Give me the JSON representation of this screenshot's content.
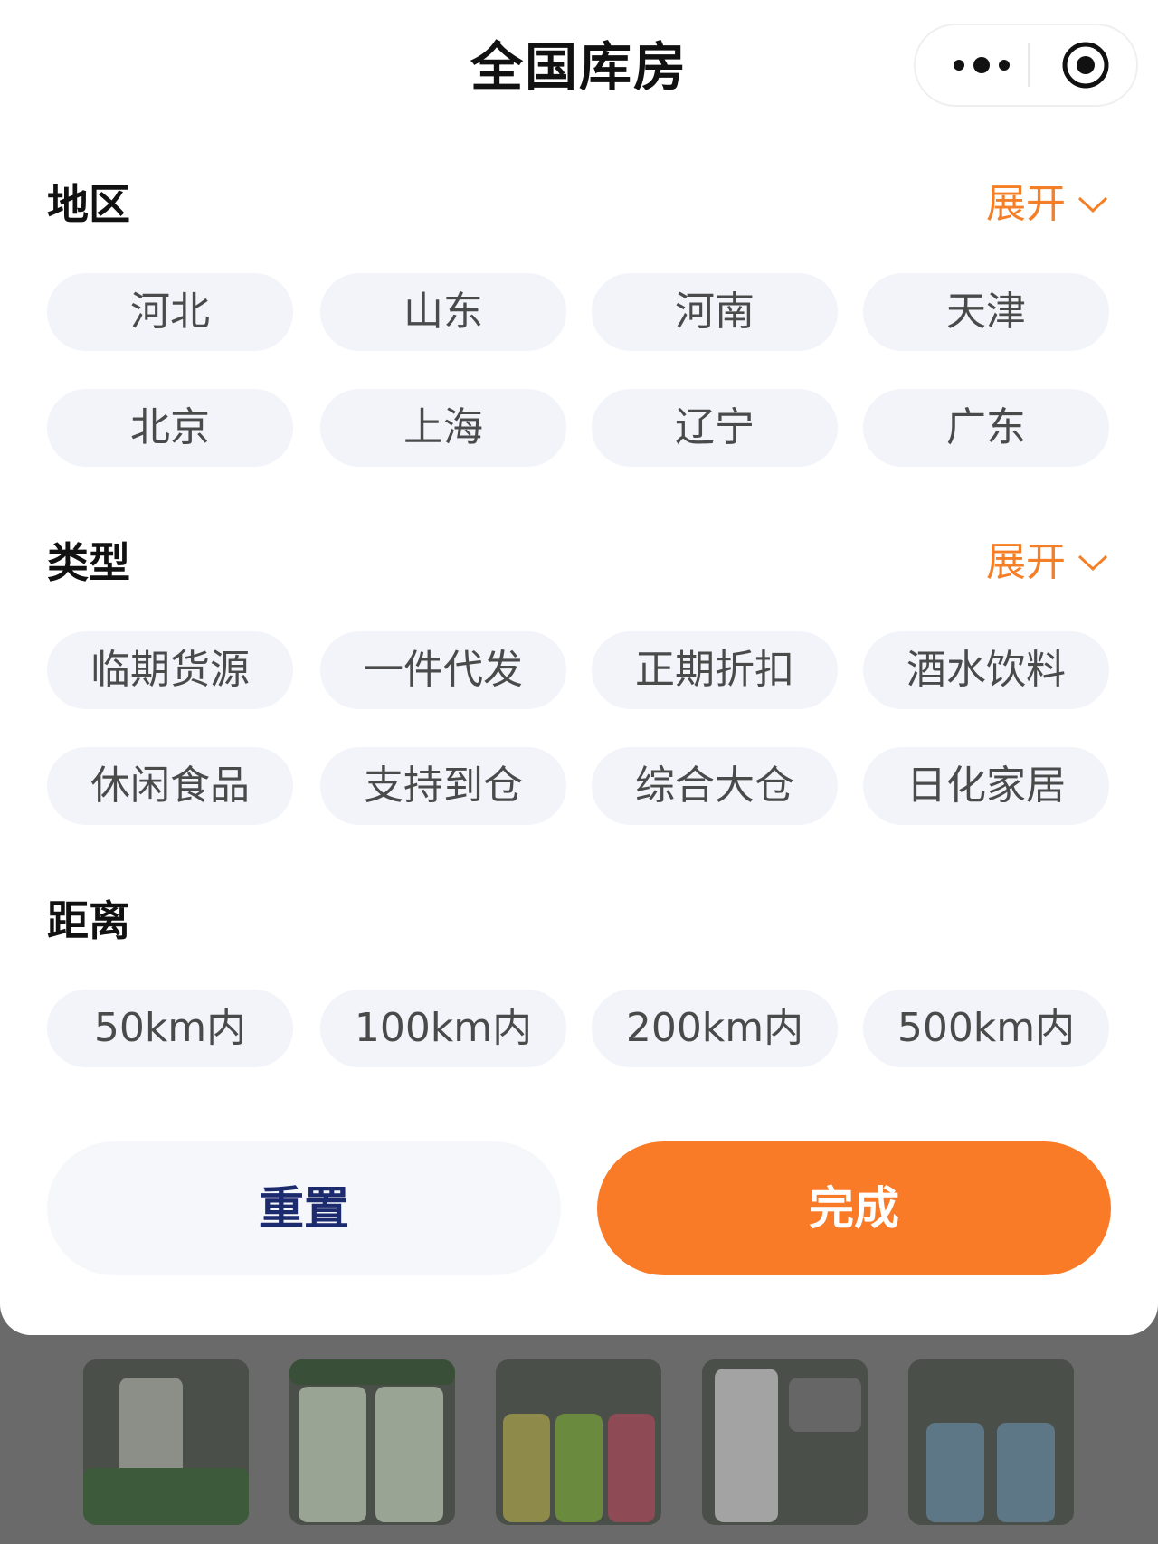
{
  "header": {
    "title": "全国库房",
    "more_icon": "more-dots-icon",
    "close_icon": "target-circle-icon"
  },
  "sections": {
    "region": {
      "title": "地区",
      "expand_label": "展开",
      "options": [
        "河北",
        "山东",
        "河南",
        "天津",
        "北京",
        "上海",
        "辽宁",
        "广东"
      ]
    },
    "type": {
      "title": "类型",
      "expand_label": "展开",
      "options": [
        "临期货源",
        "一件代发",
        "正期折扣",
        "酒水饮料",
        "休闲食品",
        "支持到仓",
        "综合大仓",
        "日化家居"
      ]
    },
    "distance": {
      "title": "距离",
      "options": [
        "50km内",
        "100km内",
        "200km内",
        "500km内"
      ]
    }
  },
  "footer": {
    "reset_label": "重置",
    "done_label": "完成"
  },
  "colors": {
    "accent": "#f97b27",
    "chip_bg": "#f2f4fa",
    "reset_text": "#1c2a6e",
    "overlay": "#5f5f5f"
  }
}
